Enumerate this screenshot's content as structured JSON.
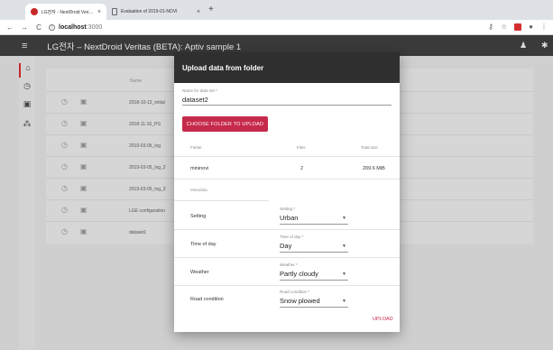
{
  "browser": {
    "tabs": [
      {
        "title": "LG전자 - NextDroid Veritas",
        "close": "×"
      },
      {
        "title": "Evaluation of 2019-01-NOVI",
        "close": "×"
      }
    ],
    "new_tab": "+",
    "url_host": "localhost",
    "url_port": ":3000",
    "nav": {
      "back": "←",
      "forward": "→",
      "reload": "C"
    }
  },
  "app": {
    "title": "LG전자 – NextDroid Veritas (BETA): Aptiv sample 1"
  },
  "table": {
    "column_name": "Name",
    "rows": [
      "2018-10-12_initial",
      "2018-11-16_PG",
      "2019-03-05_log",
      "2019-03-05_log_2",
      "2019-03-05_log_3",
      "LGE configuration",
      "dataset1"
    ]
  },
  "dialog": {
    "title": "Upload data from folder",
    "name_label": "Name for data set *",
    "name_value": "dataset2",
    "choose_button": "CHOOSE FOLDER TO UPLOAD",
    "columns": {
      "folder": "Folder",
      "files": "Files",
      "total_size": "Total size"
    },
    "folder_row": {
      "folder": "mininovi",
      "files": "2",
      "total_size": "209.6 MiB"
    },
    "metadata_label": "Metadata",
    "metadata": [
      {
        "name": "Setting",
        "select_label": "Setting *",
        "value": "Urban"
      },
      {
        "name": "Time of day",
        "select_label": "Time of day *",
        "value": "Day"
      },
      {
        "name": "Weather",
        "select_label": "Weather *",
        "value": "Partly cloudy"
      },
      {
        "name": "Road condition",
        "select_label": "Road condition *",
        "value": "Snow plowed"
      }
    ],
    "upload_button": "UPLOAD"
  },
  "colors": {
    "accent": "#c62a4b",
    "appbar": "#3a3a3a",
    "dialog_header": "#2f2f2f"
  }
}
